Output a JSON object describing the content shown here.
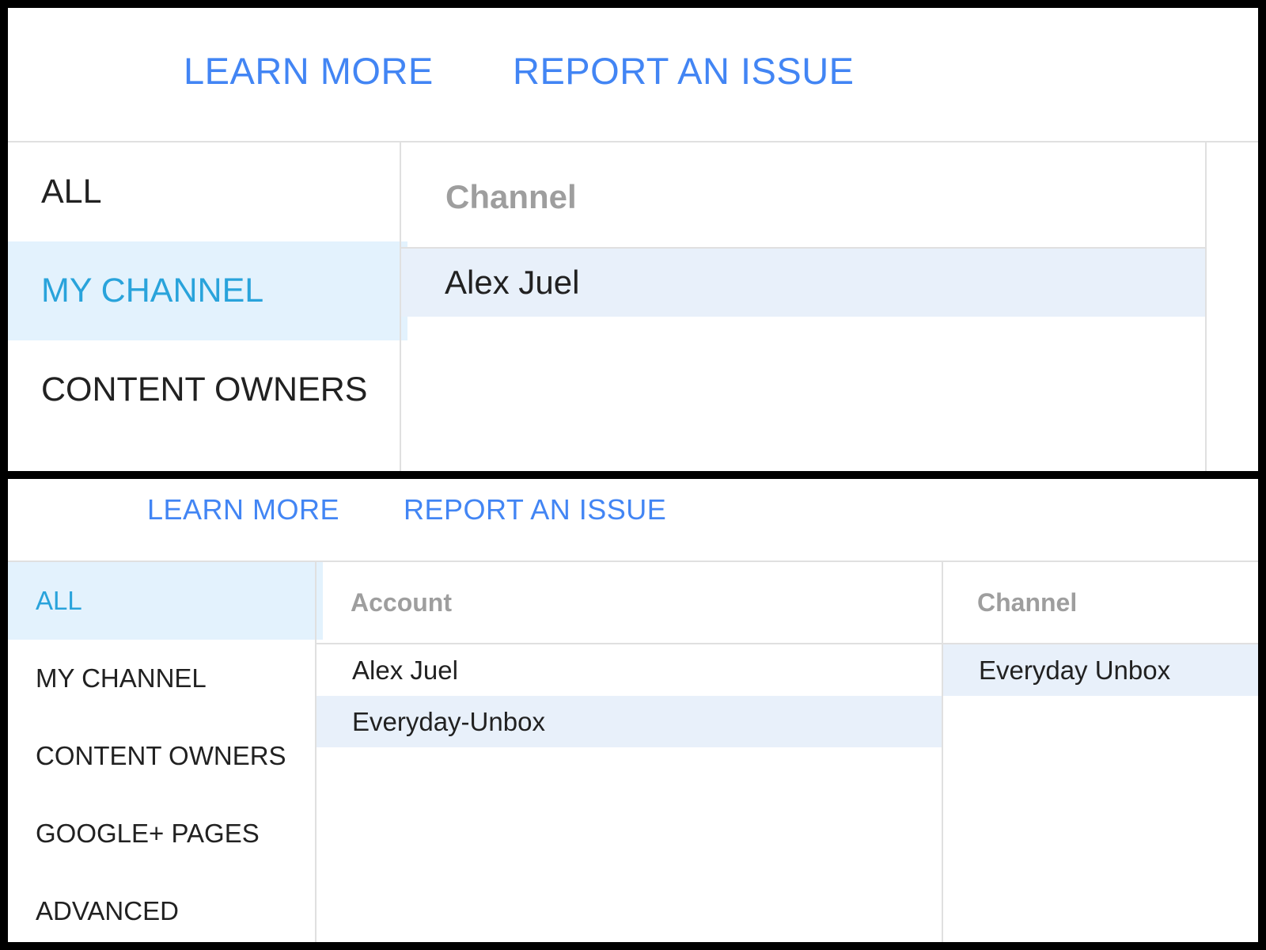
{
  "top": {
    "links": {
      "learn_more": "LEARN MORE",
      "report_issue": "REPORT AN ISSUE"
    },
    "nav": [
      {
        "label": "ALL",
        "selected": false
      },
      {
        "label": "MY CHANNEL",
        "selected": true
      },
      {
        "label": "CONTENT OWNERS",
        "selected": false
      }
    ],
    "channel_column": {
      "header": "Channel",
      "rows": [
        {
          "label": "Alex Juel",
          "selected": true
        }
      ]
    }
  },
  "bottom": {
    "links": {
      "learn_more": "LEARN MORE",
      "report_issue": "REPORT AN ISSUE"
    },
    "nav": [
      {
        "label": "ALL",
        "selected": true
      },
      {
        "label": "MY CHANNEL",
        "selected": false
      },
      {
        "label": "CONTENT OWNERS",
        "selected": false
      },
      {
        "label": "GOOGLE+ PAGES",
        "selected": false
      },
      {
        "label": "ADVANCED",
        "selected": false
      }
    ],
    "account_column": {
      "header": "Account",
      "rows": [
        {
          "label": "Alex Juel",
          "selected": false
        },
        {
          "label": "Everyday-Unbox",
          "selected": true
        }
      ]
    },
    "channel_column": {
      "header": "Channel",
      "rows": [
        {
          "label": "Everyday Unbox",
          "selected": true
        }
      ]
    }
  },
  "colors": {
    "link": "#4285f4",
    "nav_selected_text": "#29a3db",
    "nav_selected_bg": "#e3f2fd",
    "row_selected_bg": "#e8f0fa",
    "header_text": "#9e9e9e",
    "divider": "#e0e0e0"
  }
}
